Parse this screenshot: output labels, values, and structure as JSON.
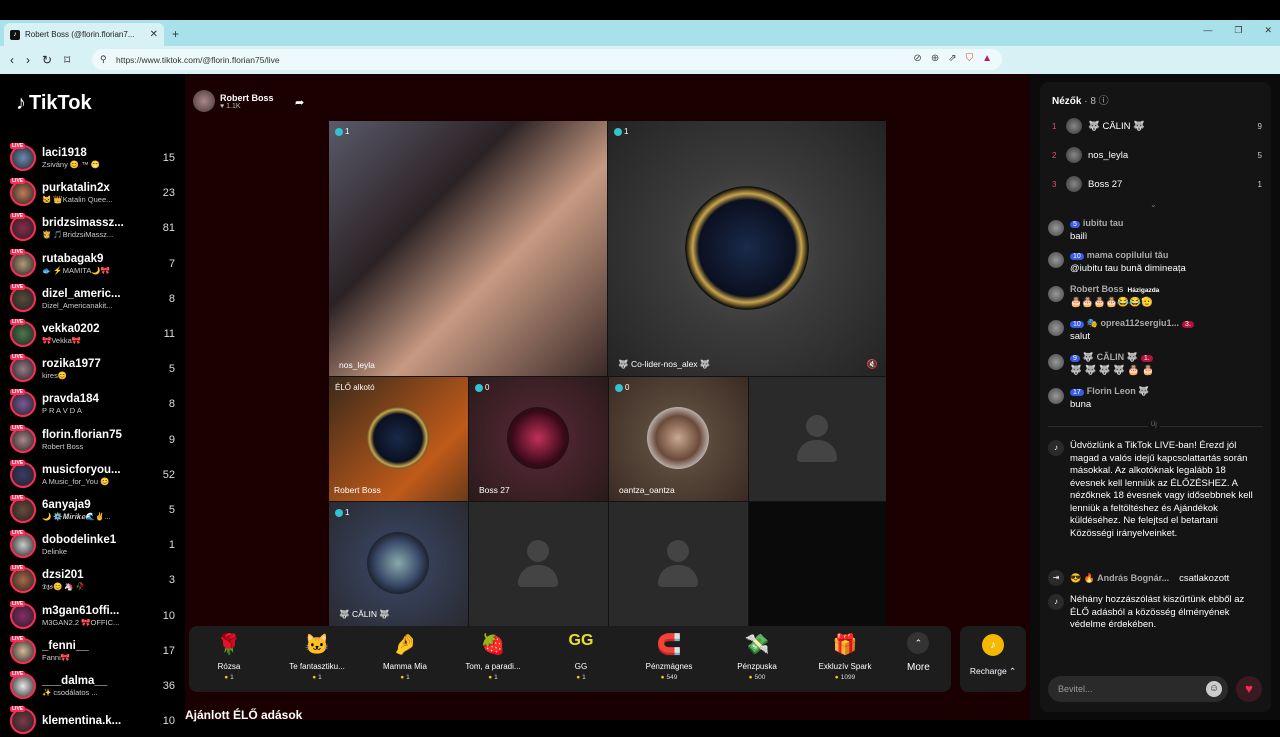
{
  "browser": {
    "tab_title": "Robert Boss (@florin.florian7...",
    "url": "https://www.tiktok.com/@florin.florian75/live"
  },
  "app": {
    "logo": "TikTok"
  },
  "sidebar": {
    "items": [
      {
        "name": "laci1918",
        "sub": "Zsivány 😊 ™ 😁",
        "count": "15",
        "color": "#6a8bb3"
      },
      {
        "name": "purkatalin2x",
        "sub": "🐱 👑Katalin Quee...",
        "count": "23",
        "color": "#c27c5a"
      },
      {
        "name": "bridzsimassz...",
        "sub": "👸 🎵BridzsiMassz...",
        "count": "81",
        "color": "#8a2a4a"
      },
      {
        "name": "rutabagak9",
        "sub": "🐟 ⚡MAMITA🌙🎀",
        "count": "7",
        "color": "#b29a7a"
      },
      {
        "name": "dizel_americ...",
        "sub": "Dizel_Americanakit...",
        "count": "8",
        "color": "#5a4a3a"
      },
      {
        "name": "vekka0202",
        "sub": "🎀Vekka🎀",
        "count": "11",
        "color": "#4a7a4a"
      },
      {
        "name": "rozika1977",
        "sub": "kires😊",
        "count": "5",
        "color": "#9a7a8a"
      },
      {
        "name": "pravda184",
        "sub": "P R A V D A",
        "count": "8",
        "color": "#7a5a9a"
      },
      {
        "name": "florin.florian75",
        "sub": "Robert Boss",
        "count": "9",
        "color": "#a88"
      },
      {
        "name": "musicforyou...",
        "sub": "A Music_for_You 😊",
        "count": "52",
        "color": "#3a3a6a"
      },
      {
        "name": "6anyaja9",
        "sub": "🌙 ⚙️𝑴𝒊𝒓𝒊𝒌𝒆🌊✌️...",
        "count": "5",
        "color": "#6a4a3a"
      },
      {
        "name": "dobodelinke1",
        "sub": "Delinke",
        "count": "1",
        "color": "#ccc"
      },
      {
        "name": "dzsi201",
        "sub": "𝕯𝖟𝖘😊 🦄 🥀",
        "count": "3",
        "color": "#aa6a4a"
      },
      {
        "name": "m3gan61offi...",
        "sub": "M3GAN2.2 🎀OFFIC...",
        "count": "10",
        "color": "#8a2a6a"
      },
      {
        "name": "_fenni__",
        "sub": "Fanni🎀",
        "count": "17",
        "color": "#d4b99a"
      },
      {
        "name": "___dalma__",
        "sub": "✨ csodálatos ...",
        "count": "36",
        "color": "#e9e9e9"
      },
      {
        "name": "klementina.k...",
        "sub": "",
        "count": "10",
        "color": "#7a3a4a"
      }
    ]
  },
  "host": {
    "name": "Robert Boss",
    "likes": "♥ 1.1K"
  },
  "cells": {
    "c1": {
      "name": "nos_leyla",
      "badge": "1"
    },
    "c2": {
      "name": "🐺 Co-lider-nos_alex 🐺",
      "badge": "1"
    },
    "c3": {
      "name": "Robert Boss",
      "tag": "ÉLŐ alkotó"
    },
    "c4": {
      "name": "Boss 27",
      "badge": "0"
    },
    "c5": {
      "name": "oantza_oantza",
      "badge": "0"
    },
    "c6": {
      "name": "🐺 CĂLIN 🐺",
      "badge": "1"
    }
  },
  "gifts": [
    {
      "name": "Rózsa",
      "price": "1",
      "icon": "🌹"
    },
    {
      "name": "Te fantasztiku...",
      "price": "1",
      "icon": "🐱"
    },
    {
      "name": "Mamma Mia",
      "price": "1",
      "icon": "🤌"
    },
    {
      "name": "Tom, a paradi...",
      "price": "1",
      "icon": "🍓"
    },
    {
      "name": "GG",
      "price": "1",
      "icon": "GG"
    },
    {
      "name": "Pénzmágnes",
      "price": "549",
      "icon": "🧲"
    },
    {
      "name": "Pénzpuska",
      "price": "500",
      "icon": "💸"
    },
    {
      "name": "Exkluzív Spark",
      "price": "1099",
      "icon": "🎁"
    }
  ],
  "more_label": "More",
  "recharge_label": "Recharge ⌃",
  "recommended": "Ajánlott ÉLŐ adások",
  "right": {
    "title": "Nézők",
    "count": "· 8 ⓘ",
    "viewers": [
      {
        "rank": "1",
        "name": "🐺 CĂLIN 🐺",
        "score": "9"
      },
      {
        "rank": "2",
        "name": "nos_leyla",
        "score": "5"
      },
      {
        "rank": "3",
        "name": "Boss 27",
        "score": "1"
      }
    ],
    "messages": [
      {
        "lvl": "5",
        "user": "iubitu tau",
        "text": "bailì"
      },
      {
        "lvl": "10",
        "user": "mama copilului tău",
        "text": "@iubitu tau bună dimineața"
      },
      {
        "lvl": "",
        "user": "Robert Boss",
        "tag": "Házigazda",
        "text": "🎂🎂🎂🎂😂😂🫡"
      },
      {
        "lvl": "10",
        "user": "🎭 oprea112sergiu1...",
        "extra": "3.",
        "text": "salut"
      },
      {
        "lvl": "9",
        "user": "🐺 CĂLIN 🐺",
        "extra": "1.",
        "text": "🐺 🐺 🐺 🐺 🎂 🎂"
      },
      {
        "lvl": "17",
        "user": "Florin Leon 🐺",
        "text": "buna"
      }
    ],
    "divider": "Új",
    "system1": "Üdvözlünk a TikTok LIVE-ban! Érezd jól magad a valós idejű kapcsolattartás során másokkal. Az alkotóknak legalább 18 évesnek kell lenniük az ÉLŐZÉSHEZ. A nézőknek 18 évesnek vagy idősebbnek kell lenniük a feltöltéshez és Ajándékok küldéséhez. Ne felejtsd el betartani Közösségi irányelveinket.",
    "join_user": "😎 🔥 András Bognár...",
    "join_text": "csatlakozott",
    "system2": "Néhány hozzászólást kiszűrtünk ebből az ÉLŐ adásból a közösség élményének védelme érdekében.",
    "input_placeholder": "Bevitel..."
  }
}
